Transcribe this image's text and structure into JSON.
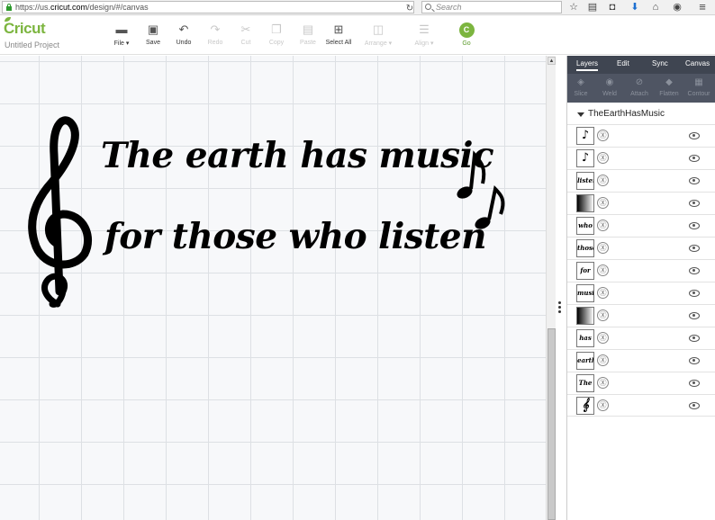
{
  "browser": {
    "url_prefix": "https://us.",
    "url_domain": "cricut.com",
    "url_path": "/design/#/canvas",
    "search_placeholder": "Search"
  },
  "app": {
    "logo": "Cricut",
    "project_name": "Untitled Project",
    "accent_color": "#7cb53f",
    "toolbar": [
      {
        "label": "File ▾",
        "icon": "folder-icon",
        "enabled": true
      },
      {
        "label": "Save",
        "icon": "save-icon",
        "enabled": true
      },
      {
        "label": "Undo",
        "icon": "undo-icon",
        "enabled": true
      },
      {
        "label": "Redo",
        "icon": "redo-icon",
        "enabled": false
      },
      {
        "label": "Cut",
        "icon": "cut-icon",
        "enabled": false
      },
      {
        "label": "Copy",
        "icon": "copy-icon",
        "enabled": false
      },
      {
        "label": "Paste",
        "icon": "paste-icon",
        "enabled": false
      },
      {
        "label": "Select All",
        "icon": "select-all-icon",
        "enabled": true
      },
      {
        "label": "Arrange ▾",
        "icon": "arrange-icon",
        "enabled": false
      },
      {
        "label": "Align ▾",
        "icon": "align-icon",
        "enabled": false
      }
    ],
    "go": {
      "label": "Go",
      "letter": "C"
    }
  },
  "canvas": {
    "line1": "The earth has music",
    "line2": "for those who listen"
  },
  "panel": {
    "tabs": [
      "Layers",
      "Edit",
      "Sync",
      "Canvas"
    ],
    "active_tab": "Layers",
    "tools": [
      {
        "label": "Slice",
        "icon": "slice-icon"
      },
      {
        "label": "Weld",
        "icon": "weld-icon"
      },
      {
        "label": "Attach",
        "icon": "attach-icon"
      },
      {
        "label": "Flatten",
        "icon": "flatten-icon"
      },
      {
        "label": "Contour",
        "icon": "contour-icon"
      }
    ],
    "group_name": "TheEarthHasMusic",
    "layers": [
      {
        "thumb": "♪",
        "kind": "glyph"
      },
      {
        "thumb": "♪",
        "kind": "glyph"
      },
      {
        "thumb": "listen",
        "kind": "text"
      },
      {
        "thumb": "",
        "kind": "gradient"
      },
      {
        "thumb": "who",
        "kind": "text"
      },
      {
        "thumb": "those",
        "kind": "text"
      },
      {
        "thumb": "for",
        "kind": "text"
      },
      {
        "thumb": "music",
        "kind": "text"
      },
      {
        "thumb": "",
        "kind": "gradient"
      },
      {
        "thumb": "has",
        "kind": "text"
      },
      {
        "thumb": "earth",
        "kind": "text"
      },
      {
        "thumb": "The",
        "kind": "text"
      },
      {
        "thumb": "𝄞",
        "kind": "glyph"
      }
    ]
  }
}
